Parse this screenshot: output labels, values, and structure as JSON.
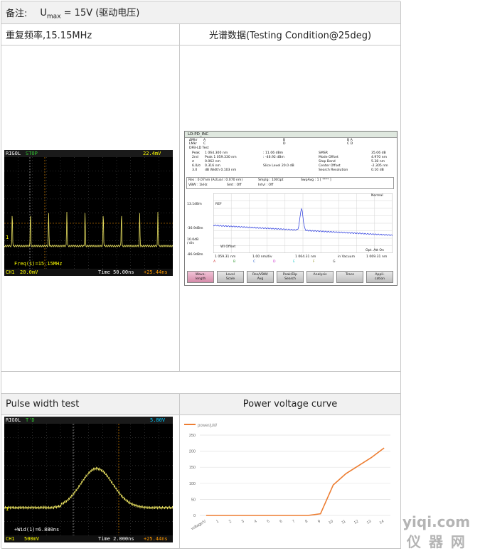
{
  "doc": {
    "note_label": "备注:",
    "note_symbol": "U",
    "note_sub": "max",
    "note_rest": " = 15V (驱动电压)",
    "rep_label": "重复频率,15.15MHz",
    "spec_label": "光谱数据(Testing Condition@25deg)",
    "pulse_label": "Pulse width test",
    "curve_label": "Power voltage curve"
  },
  "scope1": {
    "brand": "RIGOL",
    "state": "STOP",
    "trig": "22.4mV",
    "meas": "Freq(1)=15.15MHz",
    "ch": "CH1",
    "ch_scale": "20.0mV",
    "time": "Time 50.00ns",
    "offset": "+25.44ns"
  },
  "scope2": {
    "brand": "RIGOL",
    "state": "T'D",
    "trig": "5.80V",
    "meas": "+Wid(1)=6.880ns",
    "ch": "CH1",
    "ch_scale": "500mV",
    "time": "Time 2.000ns",
    "offset": "+25.44ns"
  },
  "osa": {
    "title": "LD-PD_INC",
    "mkr_left": [
      "ΔMkr",
      "LMkr"
    ],
    "mkr_a": [
      "A",
      "C"
    ],
    "mkr_b": [
      "B",
      "D"
    ],
    "mkr_ba": [
      "B A",
      "C D"
    ],
    "test": "DFB-LD Test",
    "rows": [
      [
        "Peak",
        "1 064.300 nm",
        ": 11.06  dBm",
        "SMSR",
        "35.06 dB"
      ],
      [
        "2nd",
        "Peak   1 059.330 nm",
        ": -46.92  dBm",
        "Mode Offset",
        "4.970 nm"
      ],
      [
        "σ",
        "0.062 nm",
        "",
        "Stop Band",
        "5.38 nm"
      ],
      [
        "6.0/σ",
        "0.316 nm",
        "Slice Level  20.0  dB",
        "Center Offset",
        "-2.305 nm"
      ],
      [
        "3.0",
        "dB Width   0.103 nm",
        "",
        "Search Resolution",
        "0.10 dB"
      ]
    ],
    "res": "Res : 0.07nm (Actual : 0.070 nm)",
    "smpl": "Smplg : 1001pt",
    "swp": "SwpAvg :  1 [   **** ]",
    "vbw": "VBW  :  1kHz",
    "sm": "Smt :  Off",
    "intl": "Intvl :  Off",
    "normal": "Normal",
    "y_top": "13.1dBm",
    "y_mid": "-36.9dBm",
    "y_div": "10.0dB",
    "y_div2": "/ div",
    "y_bot": "-86.9dBm",
    "ref": "REF",
    "wl_offset": "WI Offset",
    "opt_att": "Opt. Att On",
    "x_left": "1 059.31 nm",
    "x_div": "1.00 nm/div",
    "x_center": "1 064.31 nm",
    "x_vac": "in Vacuum",
    "x_right": "1 069.31 nm",
    "trace_letters": [
      "A",
      "B",
      "C",
      "D",
      "E",
      "F",
      "G"
    ],
    "softkeys": [
      [
        "Wave-",
        "length"
      ],
      [
        "Level",
        "Scale"
      ],
      [
        "Res/VBW/",
        "Avg"
      ],
      [
        "Peak/Dip",
        "Search"
      ],
      [
        "Analysis",
        ""
      ],
      [
        "Trace",
        ""
      ],
      [
        "Appli-",
        "cation"
      ]
    ]
  },
  "chart_data": {
    "type": "line",
    "title": "",
    "legend": "power/μW",
    "legend_position": "top-left",
    "xlabel": "",
    "ylabel": "",
    "x": [
      "voltage/V",
      "1",
      "2",
      "3",
      "4",
      "5",
      "6",
      "7",
      "8",
      "9",
      "10",
      "11",
      "12",
      "13",
      "14"
    ],
    "y": [
      0,
      0,
      0,
      0,
      0,
      0,
      0,
      0,
      0,
      5,
      95,
      130,
      155,
      180,
      210
    ],
    "yticks": [
      0,
      50,
      100,
      150,
      200,
      250
    ],
    "ylim": [
      0,
      250
    ],
    "grid": true,
    "color": "#ed7d31"
  },
  "watermark": {
    "line1": "yiqi.com",
    "line2": "仪 器 网"
  }
}
